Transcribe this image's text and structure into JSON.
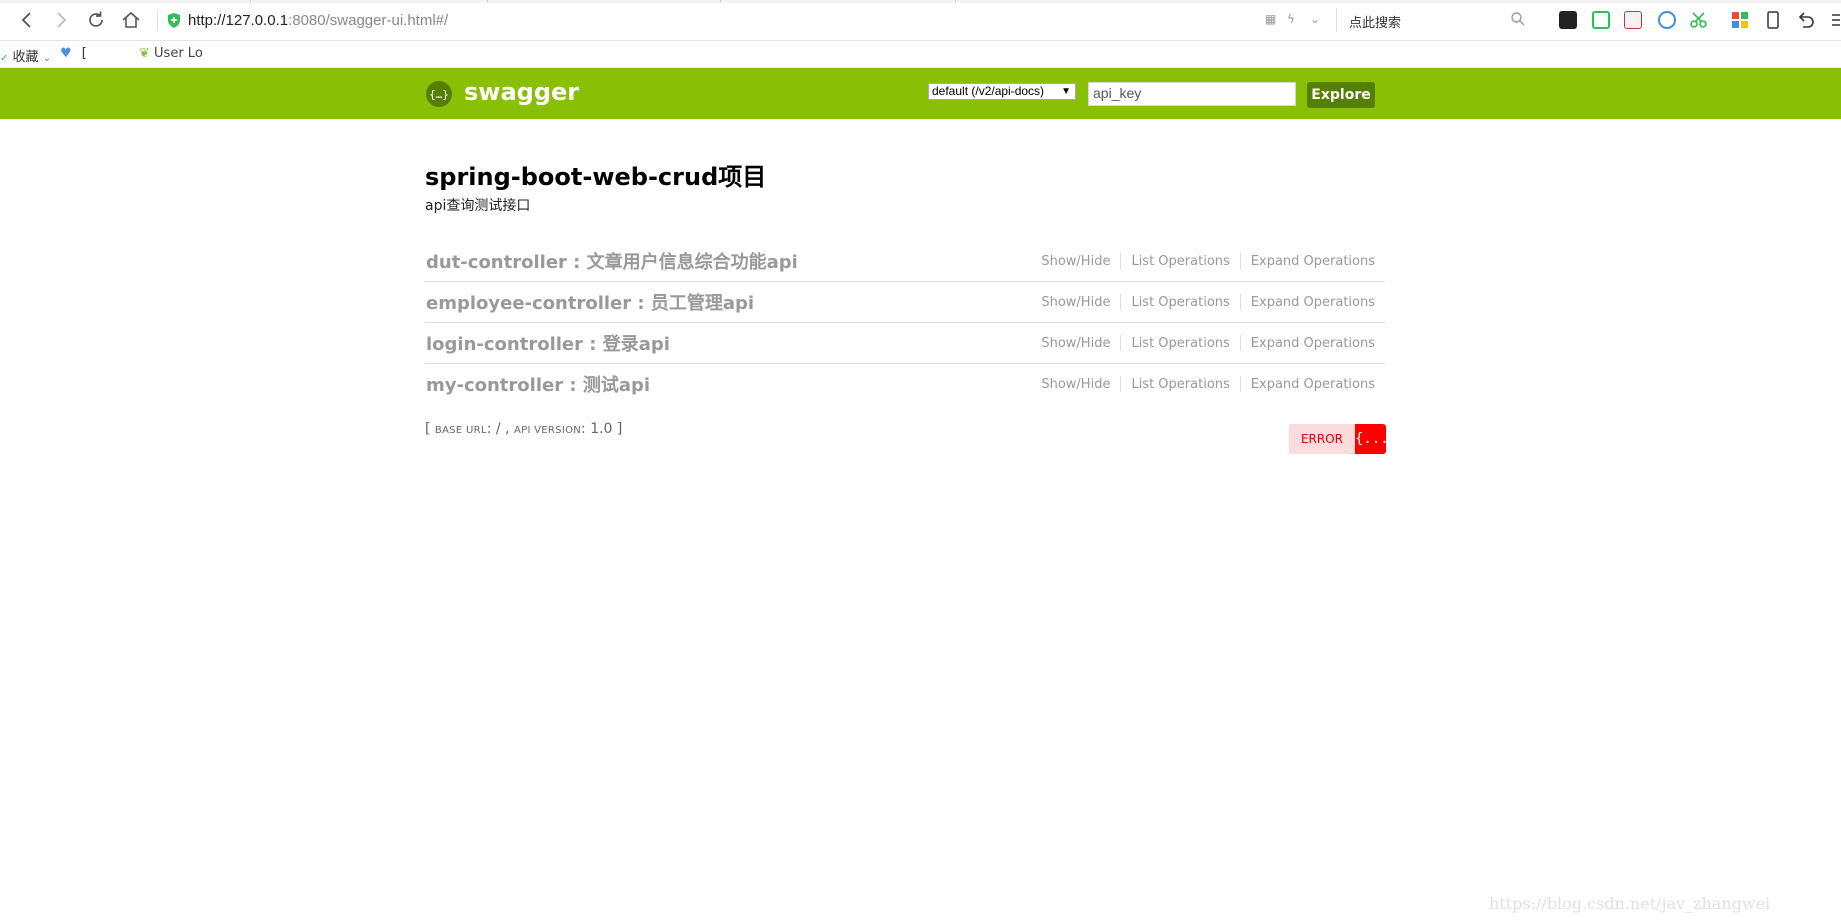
{
  "browser": {
    "url_host": "http://127.0.0.1",
    "url_rest": ":8080/swagger-ui.html#/",
    "search_placeholder": "点此搜索",
    "colors": {
      "shield": "#2fbf54"
    }
  },
  "bookmarks": [
    {
      "icon": "star-icon",
      "label": "收藏"
    },
    {
      "icon": "heart-icon",
      "label": "["
    },
    {
      "icon": "leaf-icon",
      "label": "User Lo"
    }
  ],
  "swagger": {
    "brand": "swagger",
    "spec_select": "default (/v2/api-docs)",
    "api_key_placeholder": "api_key",
    "explore_label": "Explore",
    "colors": {
      "header": "#89bf04",
      "explore": "#547f00"
    }
  },
  "info": {
    "title": "spring-boot-web-crud项目",
    "description": "api查询测试接口"
  },
  "resources": [
    {
      "name": "dut-controller : 文章用户信息综合功能api"
    },
    {
      "name": "employee-controller : 员工管理api"
    },
    {
      "name": "login-controller : 登录api"
    },
    {
      "name": "my-controller : 测试api"
    }
  ],
  "resource_actions": {
    "show_hide": "Show/Hide",
    "list_operations": "List Operations",
    "expand_operations": "Expand Operations"
  },
  "footer": {
    "open_bracket": "[",
    "base_url_label": "base url",
    "base_url_value": ": / ,",
    "api_version_label": "api version",
    "api_version_value": ": 1.0",
    "close_bracket": "]"
  },
  "validator": {
    "label": "ERROR",
    "icon_text": "{...}"
  },
  "watermark": "https://blog.csdn.net/jav_zhangwei"
}
